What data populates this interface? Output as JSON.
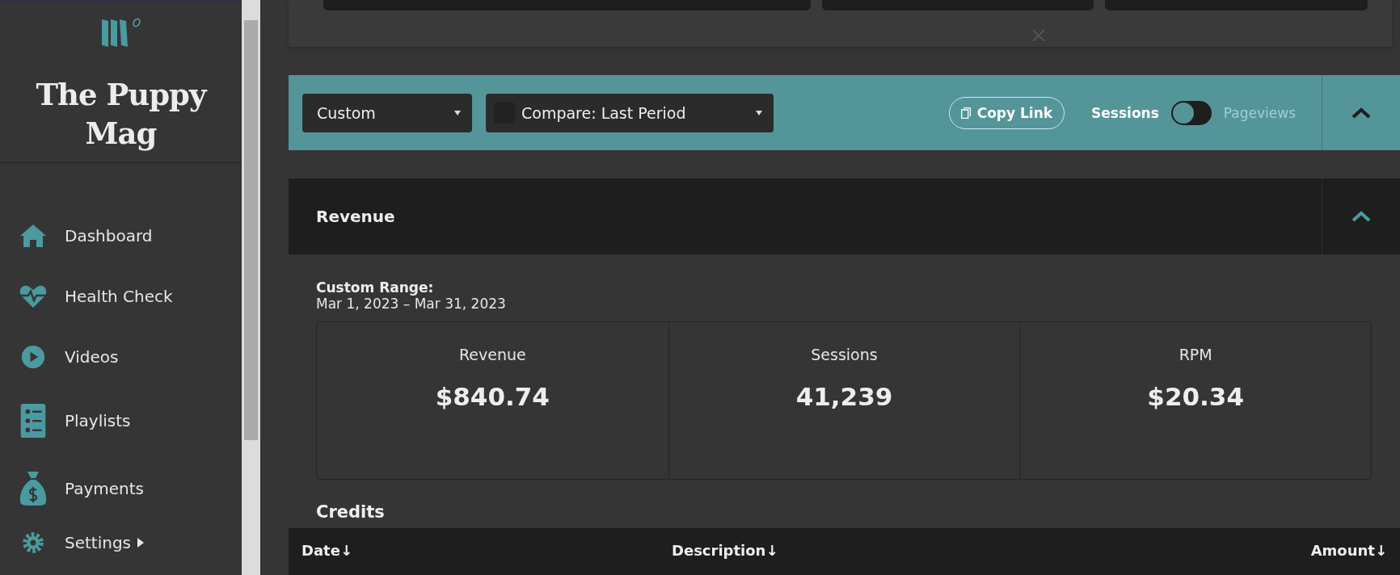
{
  "sidebar": {
    "brand": "The Puppy Mag",
    "items": [
      {
        "label": "Dashboard",
        "submenu": false
      },
      {
        "label": "Health Check",
        "submenu": false
      },
      {
        "label": "Videos",
        "submenu": false
      },
      {
        "label": "Playlists",
        "submenu": false
      },
      {
        "label": "Payments",
        "submenu": false
      },
      {
        "label": "Settings",
        "submenu": true
      }
    ]
  },
  "toolbar": {
    "range": "Custom",
    "compare": "Compare: Last Period",
    "copy_link": "Copy Link",
    "toggle": {
      "on": false,
      "options": [
        {
          "label": "Sessions",
          "selected": true
        },
        {
          "label": "Pageviews",
          "selected": false
        }
      ]
    },
    "expanded": true
  },
  "revenue": {
    "title": "Revenue",
    "expanded": true,
    "range_label": "Custom Range:",
    "range": "Mar 1, 2023 – Mar 31, 2023",
    "stats": [
      {
        "label": "Revenue",
        "value": "$840.74"
      },
      {
        "label": "Sessions",
        "value": "41,239"
      },
      {
        "label": "RPM",
        "value": "$20.34"
      }
    ],
    "credits": {
      "title": "Credits",
      "columns": [
        "Date↓",
        "Description↓",
        "Amount↓"
      ]
    }
  }
}
